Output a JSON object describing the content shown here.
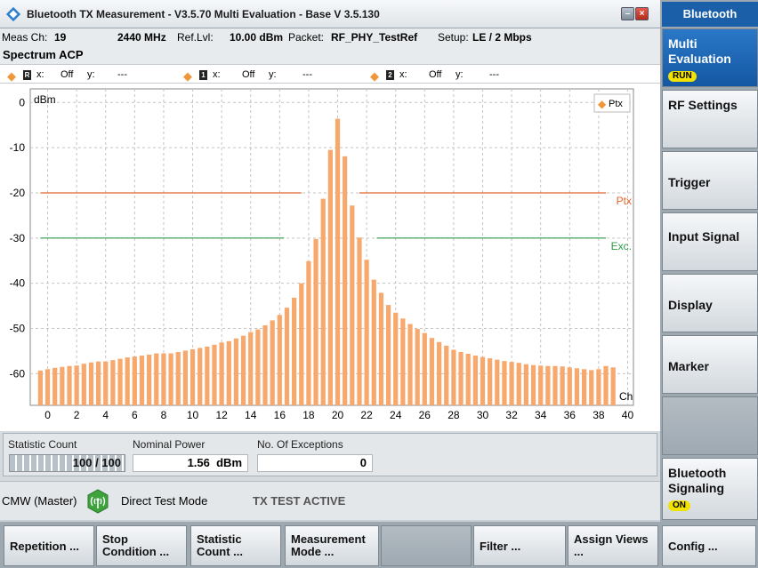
{
  "window": {
    "title": "Bluetooth TX Measurement  - V3.5.70 Multi Evaluation - Base V 3.5.130",
    "minimize_label": "–",
    "close_label": "×"
  },
  "info": {
    "meas_ch_label": "Meas Ch:",
    "meas_ch_value": "19",
    "frequency": "2440 MHz",
    "ref_lvl_label": "Ref.Lvl:",
    "ref_lvl_value": "10.00 dBm",
    "packet_label": "Packet:",
    "packet_value": "RF_PHY_TestRef",
    "setup_label": "Setup:",
    "setup_value": "LE / 2 Mbps"
  },
  "section_title": "Spectrum ACP",
  "markers": [
    {
      "id": "R",
      "x_label": "x:",
      "x_value": "Off",
      "y_label": "y:",
      "y_value": "---"
    },
    {
      "id": "1",
      "x_label": "x:",
      "x_value": "Off",
      "y_label": "y:",
      "y_value": "---"
    },
    {
      "id": "2",
      "x_label": "x:",
      "x_value": "Off",
      "y_label": "y:",
      "y_value": "---"
    }
  ],
  "chart_data": {
    "type": "bar",
    "ylabel": "dBm",
    "xlabel": "Ch",
    "ylim": [
      -67,
      3
    ],
    "xlim": [
      -1.2,
      40.4
    ],
    "yticks": [
      0,
      -10,
      -20,
      -30,
      -40,
      -50,
      -60
    ],
    "xticks": [
      0,
      2,
      4,
      6,
      8,
      10,
      12,
      14,
      16,
      18,
      20,
      22,
      24,
      26,
      28,
      30,
      32,
      34,
      36,
      38,
      40
    ],
    "x": [
      -0.5,
      0,
      0.5,
      1,
      1.5,
      2,
      2.5,
      3,
      3.5,
      4,
      4.5,
      5,
      5.5,
      6,
      6.5,
      7,
      7.5,
      8,
      8.5,
      9,
      9.5,
      10,
      10.5,
      11,
      11.5,
      12,
      12.5,
      13,
      13.5,
      14,
      14.5,
      15,
      15.5,
      16,
      16.5,
      17,
      17.5,
      18,
      18.5,
      19,
      19.5,
      20,
      20.5,
      21,
      21.5,
      22,
      22.5,
      23,
      23.5,
      24,
      24.5,
      25,
      25.5,
      26,
      26.5,
      27,
      27.5,
      28,
      28.5,
      29,
      29.5,
      30,
      30.5,
      31,
      31.5,
      32,
      32.5,
      33,
      33.5,
      34,
      34.5,
      35,
      35.5,
      36,
      36.5,
      37,
      37.5,
      38,
      38.5,
      39
    ],
    "values": [
      -59.3,
      -59,
      -58.7,
      -58.5,
      -58.3,
      -58.2,
      -57.8,
      -57.5,
      -57.3,
      -57.3,
      -57,
      -56.7,
      -56.4,
      -56.2,
      -56,
      -55.8,
      -55.5,
      -55.5,
      -55.5,
      -55.2,
      -54.9,
      -54.6,
      -54.3,
      -54,
      -53.6,
      -53.1,
      -52.8,
      -52.2,
      -51.6,
      -50.8,
      -50.2,
      -49.3,
      -48.2,
      -47,
      -45.4,
      -43.2,
      -40,
      -35.1,
      -30.2,
      -21.3,
      -10.5,
      -3.6,
      -11.9,
      -22.8,
      -29.9,
      -34.8,
      -39.2,
      -42.1,
      -44.8,
      -46.5,
      -47.8,
      -49,
      -50.1,
      -51,
      -52.1,
      -53,
      -53.8,
      -54.7,
      -55.2,
      -55.6,
      -56,
      -56.3,
      -56.6,
      -56.9,
      -57.2,
      -57.4,
      -57.6,
      -57.9,
      -58.1,
      -58.2,
      -58.3,
      -58.3,
      -58.4,
      -58.6,
      -58.8,
      -59,
      -59.2,
      -59,
      -58.3,
      -58.6,
      -58.8
    ],
    "limit_lines": [
      {
        "name": "Ptx",
        "y": -20,
        "segments": [
          [
            -0.5,
            17.5
          ],
          [
            21.5,
            38.5
          ]
        ],
        "color": "#e2642a"
      },
      {
        "name": "Exc.",
        "y": -30,
        "segments": [
          [
            -0.5,
            16.3
          ],
          [
            22.7,
            38.5
          ]
        ],
        "color": "#2d9a4a"
      }
    ],
    "legend": {
      "label": "Ptx",
      "position": "top-right"
    },
    "bar_color": "#f7a86c",
    "grid": true
  },
  "stats": {
    "statistic_count_label": "Statistic Count",
    "statistic_count_value": "100 / 100",
    "statistic_progress": 1.0,
    "nominal_power_label": "Nominal Power",
    "nominal_power_value": "1.56",
    "nominal_power_unit": "dBm",
    "exceptions_label": "No. Of Exceptions",
    "exceptions_value": "0"
  },
  "status": {
    "instrument": "CMW (Master)",
    "mode": "Direct Test Mode",
    "state": "TX TEST ACTIVE"
  },
  "sidebar": {
    "header": "Bluetooth",
    "items": [
      {
        "label": "Multi Evaluation",
        "badge": "RUN",
        "active": true
      },
      {
        "label": "RF Settings"
      },
      {
        "label": "Trigger"
      },
      {
        "label": "Input Signal"
      },
      {
        "label": "Display"
      },
      {
        "label": "Marker"
      },
      {
        "label": ""
      },
      {
        "label": "Bluetooth Signaling",
        "badge": "ON"
      }
    ]
  },
  "softkeys": [
    {
      "label": "Repetition ..."
    },
    {
      "label": "Stop Condition ..."
    },
    {
      "label": "Statistic Count ..."
    },
    {
      "label": "Measurement Mode ..."
    },
    {
      "label": ""
    },
    {
      "label": "Filter ..."
    },
    {
      "label": "Assign Views ..."
    },
    {
      "label": "Config ..."
    }
  ],
  "colors": {
    "accent": "#1a5fa8",
    "badge": "#f2e200",
    "marker": "#f0963a"
  }
}
